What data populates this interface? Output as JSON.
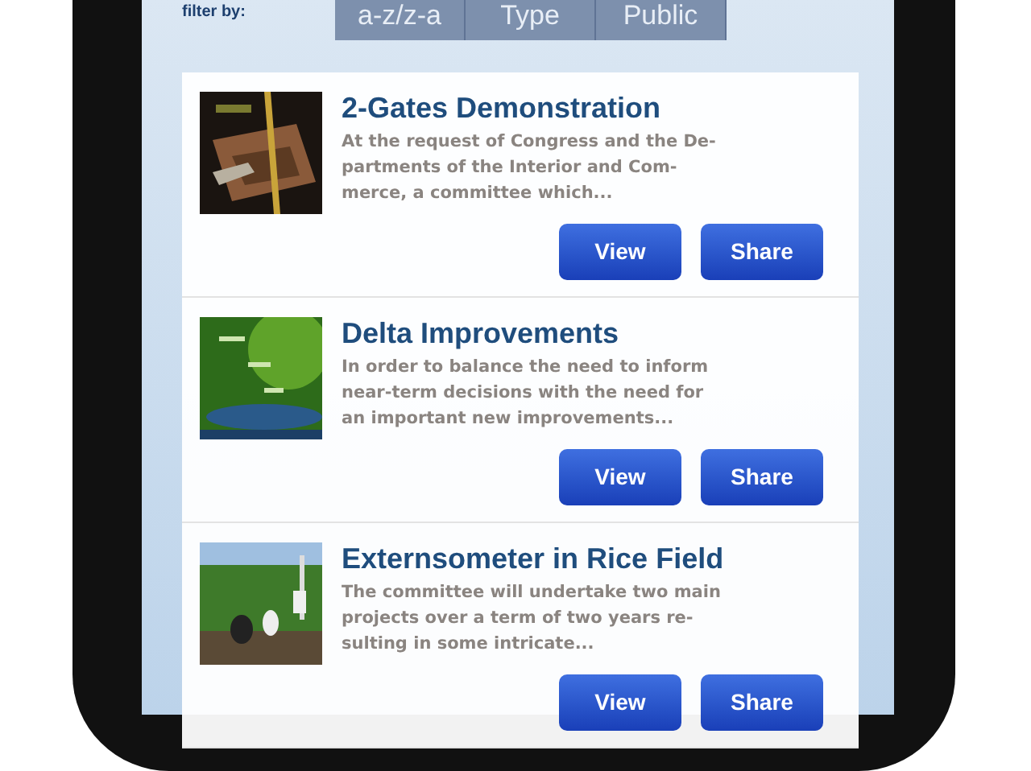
{
  "filter": {
    "label": "filter by:",
    "tabs": [
      {
        "label": "a-z/z-a"
      },
      {
        "label": "Type"
      },
      {
        "label": "Public"
      }
    ]
  },
  "items": [
    {
      "title": "2-Gates Demonstration",
      "description": "At the request of Congress and the De-\npartments of the Interior and Com-\nmerce, a committee which...",
      "thumbnail": {
        "kind": "picture"
      },
      "buttons": [
        "View",
        "Share"
      ]
    },
    {
      "title": "Delta Improvements",
      "description": "In order to balance the need to inform\nnear-term decisions with the need for\nan important new improvements...",
      "thumbnail": {
        "kind": "picture"
      },
      "buttons": [
        "View",
        "Share"
      ]
    },
    {
      "title": "Externsometer in Rice Field",
      "description": "The committee will undertake two main\nprojects over a term of two years re-\nsulting in some intricate...",
      "thumbnail": {
        "kind": "picture"
      },
      "buttons": [
        "View",
        "Share"
      ]
    }
  ]
}
